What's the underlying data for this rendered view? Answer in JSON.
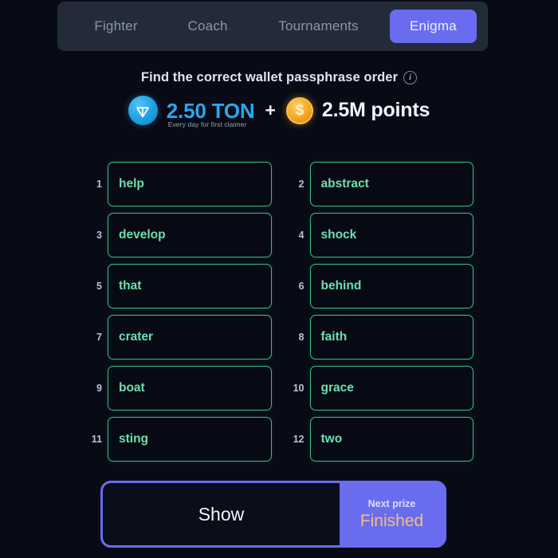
{
  "tabs": [
    {
      "label": "Fighter",
      "active": false
    },
    {
      "label": "Coach",
      "active": false
    },
    {
      "label": "Tournaments",
      "active": false
    },
    {
      "label": "Enigma",
      "active": true
    }
  ],
  "headline": {
    "text": "Find the correct wallet passphrase order",
    "info_icon": "i"
  },
  "prize": {
    "ton_icon": "ton-diamond-icon",
    "ton_amount": "2.50 TON",
    "ton_subtitle": "Every day for first claimer",
    "plus": "+",
    "points_icon": "$",
    "points_amount": "2.5M points"
  },
  "words": [
    {
      "index": "1",
      "word": "help"
    },
    {
      "index": "2",
      "word": "abstract"
    },
    {
      "index": "3",
      "word": "develop"
    },
    {
      "index": "4",
      "word": "shock"
    },
    {
      "index": "5",
      "word": "that"
    },
    {
      "index": "6",
      "word": "behind"
    },
    {
      "index": "7",
      "word": "crater"
    },
    {
      "index": "8",
      "word": "faith"
    },
    {
      "index": "9",
      "word": "boat"
    },
    {
      "index": "10",
      "word": "grace"
    },
    {
      "index": "11",
      "word": "sting"
    },
    {
      "index": "12",
      "word": "two"
    }
  ],
  "bottom": {
    "show_label": "Show",
    "next_prize_label": "Next prize",
    "next_prize_value": "Finished"
  },
  "colors": {
    "background": "#080b16",
    "tabbar": "#232b39",
    "accent_purple": "#6a6cf0",
    "word_border": "#3bba82",
    "word_text": "#6fdfae",
    "ton_blue": "#2ba7ea",
    "points_gold": "#f5a623",
    "finished_amber": "#f4c173"
  }
}
